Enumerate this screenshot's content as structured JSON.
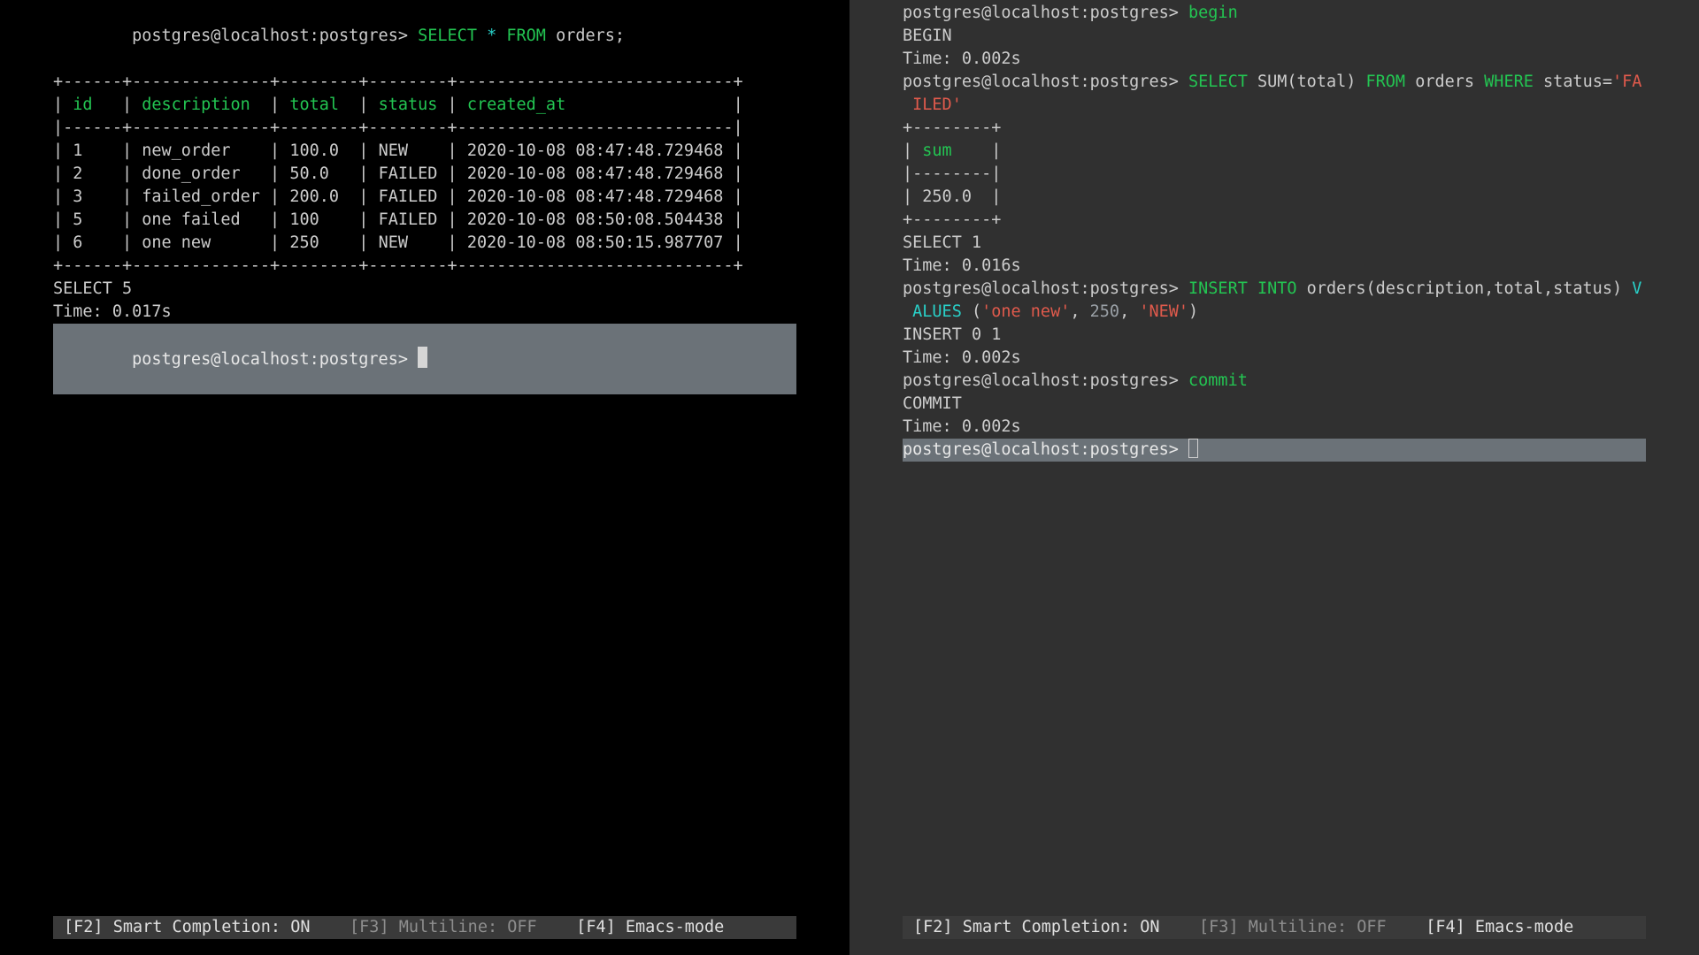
{
  "prompt": "postgres@localhost:postgres>",
  "left": {
    "query": {
      "select": "SELECT",
      "star": "*",
      "from": "FROM",
      "table": "orders",
      "semi": ";"
    },
    "border_top": "+------+--------------+--------+--------+----------------------------+",
    "border_mid": "|------+--------------+--------+--------+----------------------------|",
    "border_bottom": "+------+--------------+--------+--------+----------------------------+",
    "headers": {
      "id": "id",
      "description": "description",
      "total": "total",
      "status": "status",
      "created_at": "created_at"
    },
    "rows": [
      {
        "id": "1",
        "description": "new_order",
        "total": "100.0",
        "status": "NEW",
        "created_at": "2020-10-08 08:47:48.729468"
      },
      {
        "id": "2",
        "description": "done_order",
        "total": "50.0",
        "status": "FAILED",
        "created_at": "2020-10-08 08:47:48.729468"
      },
      {
        "id": "3",
        "description": "failed_order",
        "total": "200.0",
        "status": "FAILED",
        "created_at": "2020-10-08 08:47:48.729468"
      },
      {
        "id": "5",
        "description": "one failed",
        "total": "100",
        "status": "FAILED",
        "created_at": "2020-10-08 08:50:08.504438"
      },
      {
        "id": "6",
        "description": "one new",
        "total": "250",
        "status": "NEW",
        "created_at": "2020-10-08 08:50:15.987707"
      }
    ],
    "result": "SELECT 5",
    "time": "Time: 0.017s"
  },
  "right": {
    "lines": [
      {
        "prompt": true,
        "parts": [
          {
            "t": "begin",
            "cls": "kw-green"
          }
        ]
      },
      {
        "parts": [
          {
            "t": "BEGIN"
          }
        ]
      },
      {
        "parts": [
          {
            "t": "Time: 0.002s"
          }
        ]
      },
      {
        "prompt": true,
        "parts": [
          {
            "t": "SELECT",
            "cls": "kw-green"
          },
          {
            "t": " SUM(total) "
          },
          {
            "t": "FROM",
            "cls": "kw-green"
          },
          {
            "t": " orders "
          },
          {
            "t": "WHERE",
            "cls": "kw-green"
          },
          {
            "t": " status="
          },
          {
            "t": "'FA",
            "cls": "kw-redstr"
          }
        ]
      },
      {
        "parts": [
          {
            "t": " ILED'",
            "cls": "kw-redstr"
          }
        ]
      },
      {
        "parts": [
          {
            "t": "+--------+"
          }
        ]
      },
      {
        "parts": [
          {
            "t": "| "
          },
          {
            "t": "sum",
            "cls": "kw-green"
          },
          {
            "t": "    |"
          }
        ]
      },
      {
        "parts": [
          {
            "t": "|--------|"
          }
        ]
      },
      {
        "parts": [
          {
            "t": "| 250.0  |"
          }
        ]
      },
      {
        "parts": [
          {
            "t": "+--------+"
          }
        ]
      },
      {
        "parts": [
          {
            "t": "SELECT 1"
          }
        ]
      },
      {
        "parts": [
          {
            "t": "Time: 0.016s"
          }
        ]
      },
      {
        "prompt": true,
        "parts": [
          {
            "t": "INSERT INTO",
            "cls": "kw-green"
          },
          {
            "t": " orders(description,total,status) "
          },
          {
            "t": "V",
            "cls": "kw-cyan"
          }
        ]
      },
      {
        "parts": [
          {
            "t": " ALUES ",
            "cls": "kw-cyan"
          },
          {
            "t": "("
          },
          {
            "t": "'one new'",
            "cls": "kw-redstr"
          },
          {
            "t": ", "
          },
          {
            "t": "250",
            "cls": "kw-gray"
          },
          {
            "t": ", "
          },
          {
            "t": "'NEW'",
            "cls": "kw-redstr"
          },
          {
            "t": ")"
          }
        ]
      },
      {
        "parts": [
          {
            "t": "INSERT 0 1"
          }
        ]
      },
      {
        "parts": [
          {
            "t": "Time: 0.002s"
          }
        ]
      },
      {
        "prompt": true,
        "parts": [
          {
            "t": "commit",
            "cls": "kw-green"
          }
        ]
      },
      {
        "parts": [
          {
            "t": "COMMIT"
          }
        ]
      },
      {
        "parts": [
          {
            "t": "Time: 0.002s"
          }
        ]
      }
    ]
  },
  "statusbar": {
    "f2_label": "[F2] Smart Completion:",
    "f2_value": "ON",
    "f3": "[F3] Multiline: OFF",
    "f4": "[F4] Emacs-mode"
  },
  "chart_data": {
    "type": "table",
    "title": "orders",
    "columns": [
      "id",
      "description",
      "total",
      "status",
      "created_at"
    ],
    "rows": [
      [
        1,
        "new_order",
        100.0,
        "NEW",
        "2020-10-08 08:47:48.729468"
      ],
      [
        2,
        "done_order",
        50.0,
        "FAILED",
        "2020-10-08 08:47:48.729468"
      ],
      [
        3,
        "failed_order",
        200.0,
        "FAILED",
        "2020-10-08 08:47:48.729468"
      ],
      [
        5,
        "one failed",
        100,
        "FAILED",
        "2020-10-08 08:50:08.504438"
      ],
      [
        6,
        "one new",
        250,
        "NEW",
        "2020-10-08 08:50:15.987707"
      ]
    ],
    "aggregate": {
      "sum_total_failed": 250.0
    }
  }
}
